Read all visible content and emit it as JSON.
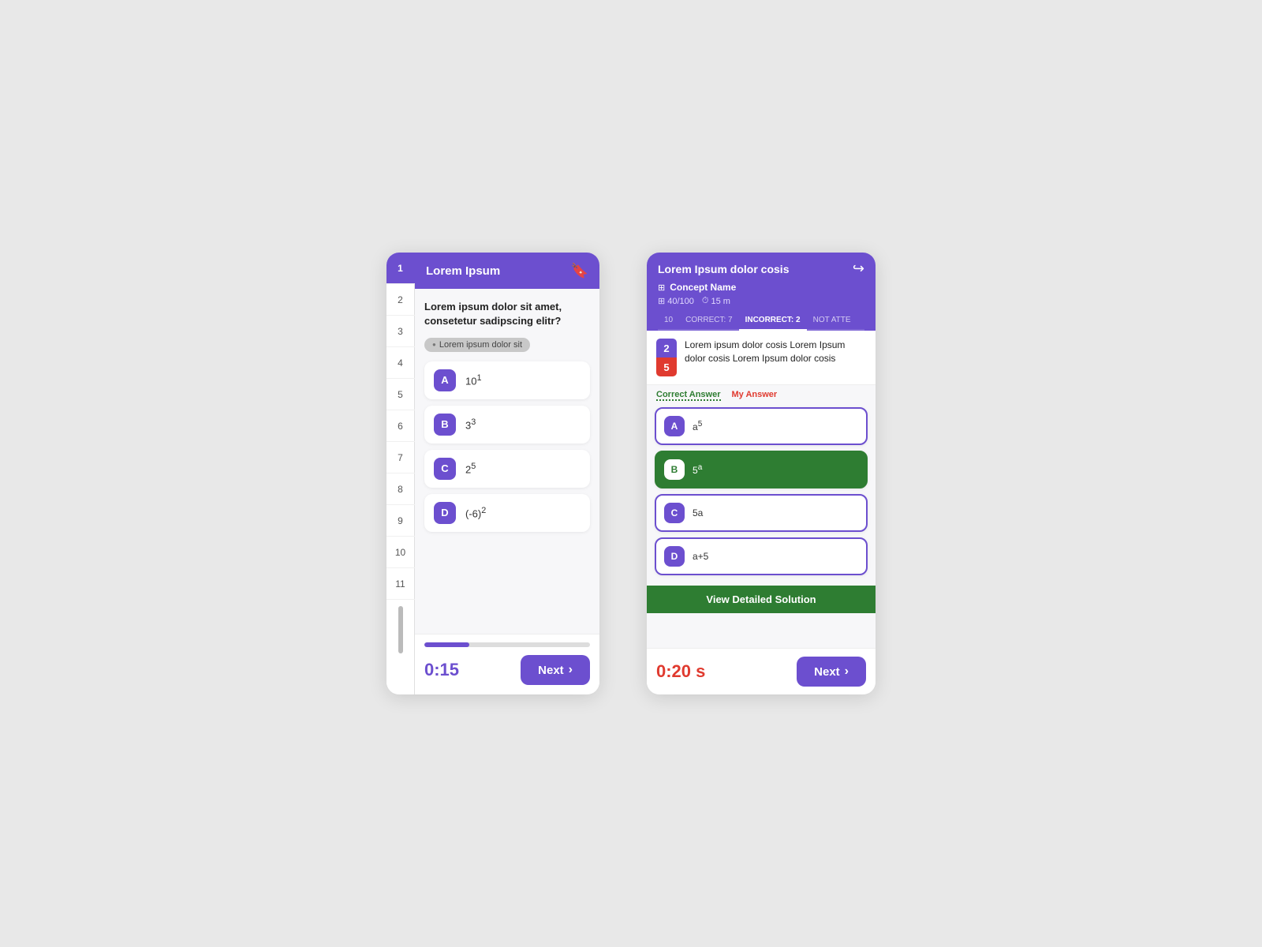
{
  "left": {
    "header": {
      "title": "Lorem Ipsum",
      "icon": "📋"
    },
    "sidebar_numbers": [
      1,
      2,
      3,
      4,
      5,
      6,
      7,
      8,
      9,
      10,
      11
    ],
    "active_number": 1,
    "question": "Lorem ipsum dolor sit amet, consetetur sadipscing elitr?",
    "tag": "Lorem ipsum dolor sit",
    "options": [
      {
        "letter": "A",
        "text": "10¹"
      },
      {
        "letter": "B",
        "text": "3³"
      },
      {
        "letter": "C",
        "text": "2⁵"
      },
      {
        "letter": "D",
        "text": "(-6)²"
      }
    ],
    "progress_percent": 27,
    "timer": "0:15",
    "next_label": "Next"
  },
  "right": {
    "header": {
      "title": "Lorem Ipsum dolor cosis",
      "share_icon": "↪"
    },
    "concept_name": "Concept Name",
    "meta": {
      "score": "40/100",
      "time": "15 m"
    },
    "tabs": [
      {
        "label": "10",
        "active": false
      },
      {
        "label": "CORRECT: 7",
        "active": false
      },
      {
        "label": "INCORRECT: 2",
        "active": true
      },
      {
        "label": "NOT ATTE",
        "active": false
      }
    ],
    "question_num": "2",
    "question_sub": "5",
    "question_text": "Lorem ipsum dolor cosis Lorem Ipsum dolor cosis Lorem Ipsum dolor cosis",
    "answer_labels": {
      "correct": "Correct Answer",
      "my": "My Answer"
    },
    "options": [
      {
        "letter": "A",
        "text": "a⁵",
        "style": "normal"
      },
      {
        "letter": "B",
        "text": "5ᵃ",
        "style": "correct"
      },
      {
        "letter": "C",
        "text": "5a",
        "style": "normal"
      },
      {
        "letter": "D",
        "text": "a+5",
        "style": "normal"
      }
    ],
    "view_solution": "View Detailed Solution",
    "timer": "0:20 s",
    "next_label": "Next"
  }
}
